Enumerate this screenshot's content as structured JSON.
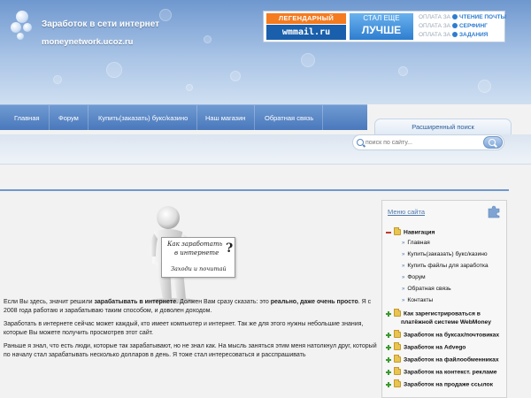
{
  "header": {
    "site_title": "Заработок в сети интернет",
    "site_domain": "moneynetwork.ucoz.ru"
  },
  "banner": {
    "badge_top": "ЛЕГЕНДАРНЫЙ",
    "badge_logo": "wmmail.ru",
    "middle_line1": "СТАЛ ЕЩЕ",
    "middle_line2": "ЛУЧШЕ",
    "rows": [
      {
        "prefix": "ОПЛАТА ЗА",
        "value": "ЧТЕНИЕ ПОЧТЫ"
      },
      {
        "prefix": "ОПЛАТА ЗА",
        "value": "СЕРФИНГ"
      },
      {
        "prefix": "ОПЛАТА ЗА",
        "value": "ЗАДАНИЯ"
      }
    ]
  },
  "nav": {
    "items": [
      "Главная",
      "Форум",
      "Купить(заказать) букс/казино",
      "Наш магазин",
      "Обратная связь"
    ],
    "advanced_search": "Расширенный поиск"
  },
  "search": {
    "placeholder": "поиск по сайту..."
  },
  "illustration": {
    "sign_line1": "Как заработать",
    "sign_line2": "в интернете",
    "sign_question": "?",
    "sign_line3": "Заходи и почитай"
  },
  "content": {
    "p1_a": "Если Вы здесь, значит решили ",
    "p1_b": "зарабатывать в интернете",
    "p1_c": ". Должен Вам сразу сказать: это ",
    "p1_d": "реально, даже очень просто",
    "p1_e": ". Я с 2008 года работаю и зарабатываю таким способом, и доволен доходом.",
    "p2": "Заработать в интернете сейчас может каждый, кто имеет компьютер и интернет. Так же для этого нужны небольшие знания, которые Вы можете получить просмотрев этот сайт.",
    "p3": "Раньше я знал, что есть люди, которые так зарабатывают, но не знал как. На мысль заняться этим меня натолкнул друг, который по началу стал зарабатывать несколько долларов в день. Я тоже стал интересоваться и расспрашивать"
  },
  "sidebar": {
    "title": "Меню сайта",
    "nav_head": "Навигация",
    "nav_items": [
      "Главная",
      "Купить(заказать) букс/казино",
      "Купить файлы для заработка",
      "Форум",
      "Обратная связь",
      "Контакты"
    ],
    "webmoney_line1": "Как зарегистрироваться в",
    "webmoney_line2": "платёжной системе WebMoney",
    "categories": [
      "Заработок на буксах/почтовиках",
      "Заработок на Advego",
      "Заработок на файлообменниках",
      "Заработок на контекст. рекламе",
      "Заработок на продаже ссылок"
    ]
  }
}
